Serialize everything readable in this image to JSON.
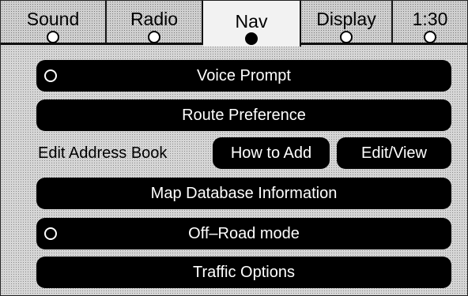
{
  "tabs": [
    {
      "label": "Sound",
      "selected": false
    },
    {
      "label": "Radio",
      "selected": false
    },
    {
      "label": "Nav",
      "selected": true
    },
    {
      "label": "Display",
      "selected": false
    },
    {
      "label": "1:30",
      "selected": false
    }
  ],
  "menu": {
    "voice_prompt": {
      "label": "Voice Prompt",
      "radio_on": false
    },
    "route_preference": {
      "label": "Route Preference"
    },
    "address_book": {
      "label": "Edit Address Book",
      "how_to_add": "How to Add",
      "edit_view": "Edit/View"
    },
    "map_database": {
      "label": "Map Database Information"
    },
    "off_road": {
      "label": "Off–Road mode",
      "radio_on": false
    },
    "traffic_options": {
      "label": "Traffic Options"
    }
  },
  "icons": {
    "tab_indicator": "radio-dot-icon",
    "option_indicator": "radio-dot-icon"
  },
  "colors": {
    "button_bg": "#000000",
    "button_text": "#ffffff",
    "screen_bg": "#d6d6d6",
    "active_tab_bg": "#f2f2f2"
  }
}
